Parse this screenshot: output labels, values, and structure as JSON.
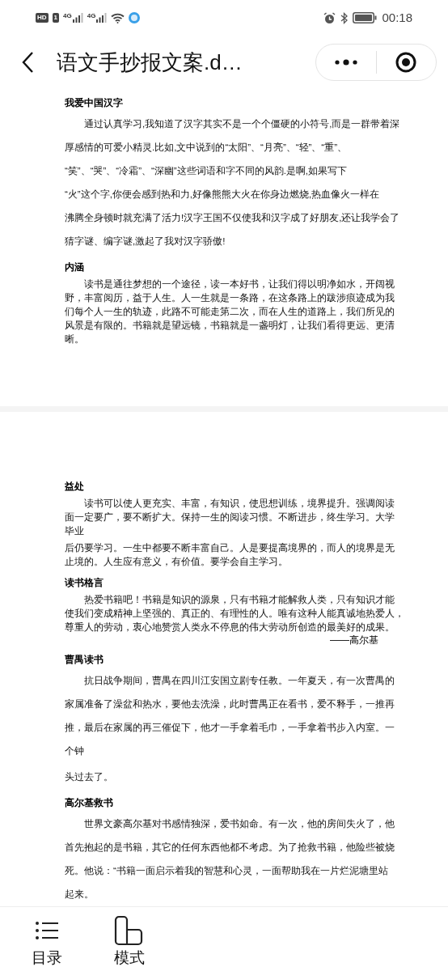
{
  "status_bar": {
    "hd": "HD",
    "sim": "1",
    "network_1": "4G",
    "network_2": "4G",
    "time": "00:18"
  },
  "header": {
    "title": "语文手抄报文案.d…"
  },
  "pages": [
    {
      "blocks": [
        {
          "kind": "heading",
          "text": "我爱中国汉字"
        },
        {
          "kind": "loose",
          "indent": true,
          "lines": [
            "通过认真学习,我知道了汉字其实不是一个个僵硬的小符号,而是一群带着深",
            "厚感情的可爱小精灵.比如,文中说到的“太阳”、“月亮”、“轻”、“重”、",
            "“笑”、“哭”、“冷霜”、“深幽”这些词语和字不同的风韵.是啊,如果写下",
            "“火”这个字,你便会感到热和力,好像熊熊大火在你身边燃烧,热血像火一样在",
            "沸腾全身顿时就充满了活力!汉字王国不仅使我和汉字成了好朋友,还让我学会了",
            "猜字谜、编字谜,激起了我对汉字骄傲!"
          ]
        },
        {
          "kind": "heading",
          "text": "内涵"
        },
        {
          "kind": "dense",
          "indent": true,
          "lines": [
            "读书是通往梦想的一个途径，读一本好书，让我们得以明净如水，开阔视",
            "野，丰富阅历，益于人生。人一生就是一条路，在这条路上的跋涉痕迹成为我",
            "们每个人一生的轨迹，此路不可能走第二次，而在人生的道路上，我们所见的",
            "风景是有限的。书籍就是望远镜，书籍就是一盏明灯，让我们看得更远、更清",
            "晰。"
          ]
        }
      ]
    },
    {
      "blocks": [
        {
          "kind": "heading",
          "text": "益处"
        },
        {
          "kind": "dense",
          "indent": true,
          "lines": [
            "读书可以使人更充实、丰富，有知识，使思想训练，境界提升。强调阅读",
            "面一定要广，要不断扩大。保持一生的阅读习惯。不断进步，终生学习。大学",
            "毕业"
          ]
        },
        {
          "kind": "dense",
          "indent": false,
          "lines": [
            "后仍要学习。一生中都要不断丰富自己。人是要提高境界的，而人的境界是无",
            "止境的。人生应有意义，有价值。要学会自主学习。"
          ]
        },
        {
          "kind": "heading",
          "text": "读书格言"
        },
        {
          "kind": "dense",
          "indent": true,
          "lines": [
            "热爱书籍吧！书籍是知识的源泉，只有书籍才能解救人类，只有知识才能",
            "使我们变成精神上坚强的、真正的、有理性的人。唯有这种人能真诚地热爱人，",
            "尊重人的劳动，衷心地赞赏人类永不停息的伟大劳动所创造的最美好的成果。"
          ]
        },
        {
          "kind": "signature",
          "text": "——高尔基"
        },
        {
          "kind": "heading",
          "text": "曹禺读书"
        },
        {
          "kind": "loose",
          "indent": true,
          "lines": [
            "抗日战争期间，曹禺在四川江安国立剧专任教。一年夏天，有一次曹禺的",
            "家属准备了澡盆和热水，要他去洗澡，此时曹禺正在看书，爱不释手，一推再",
            "推，最后在家属的再三催促下，他才一手拿着毛巾，一手拿着书步入内室。一",
            "个钟"
          ]
        },
        {
          "kind": "loose",
          "indent": false,
          "lines": [
            "头过去了。"
          ]
        },
        {
          "kind": "heading",
          "text": "高尔基救书"
        },
        {
          "kind": "loose",
          "indent": true,
          "lines": [
            "世界文豪高尔基对书感情独深，爱书如命。有一次，他的房间失火了，他",
            "首先抱起的是书籍，其它的任何东西他都不考虑。为了抢救书籍，他险些被烧",
            "死。他说：“书籍一面启示着我的智慧和心灵，一面帮助我在一片烂泥塘里站",
            "起来。"
          ]
        }
      ]
    }
  ],
  "bottom_bar": [
    {
      "kind": "contents",
      "label": "目录"
    },
    {
      "kind": "mode",
      "label": "模式"
    }
  ]
}
